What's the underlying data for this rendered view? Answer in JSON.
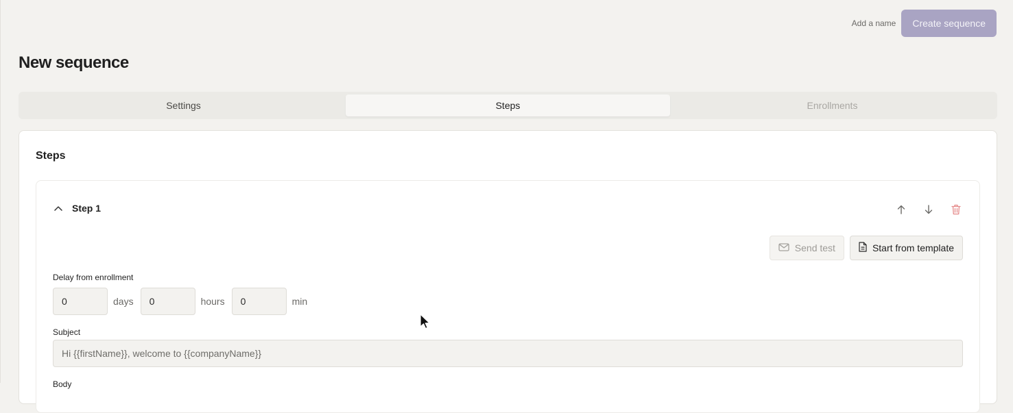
{
  "header": {
    "hint": "Add a name",
    "create_button": "Create sequence"
  },
  "page": {
    "title": "New sequence"
  },
  "tabs": [
    {
      "label": "Settings",
      "state": "normal"
    },
    {
      "label": "Steps",
      "state": "active"
    },
    {
      "label": "Enrollments",
      "state": "disabled"
    }
  ],
  "steps_panel": {
    "title": "Steps",
    "step": {
      "title": "Step 1",
      "actions": {
        "up": "arrow-up-icon",
        "down": "arrow-down-icon",
        "delete": "trash-icon"
      },
      "send_test_label": "Send test",
      "template_label": "Start from template",
      "delay_label": "Delay from enrollment",
      "delay": {
        "days": "0",
        "days_unit": "days",
        "hours": "0",
        "hours_unit": "hours",
        "min": "0",
        "min_unit": "min"
      },
      "subject_label": "Subject",
      "subject_placeholder": "Hi {{firstName}}, welcome to {{companyName}}",
      "body_label": "Body"
    }
  },
  "colors": {
    "accent_disabled": "#a9a4c3",
    "danger": "#e58a8a",
    "background": "#f3f2ef"
  }
}
